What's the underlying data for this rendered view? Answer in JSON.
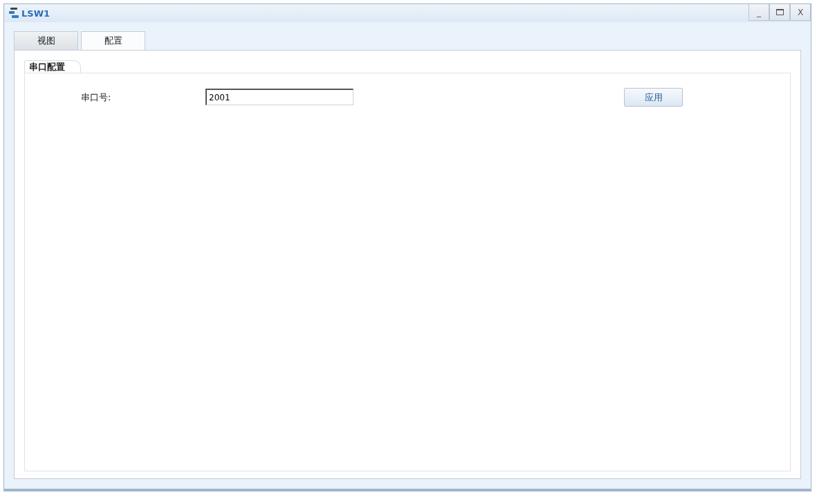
{
  "window": {
    "title": "LSW1"
  },
  "window_controls": [
    "_",
    "X"
  ],
  "tabs": [
    {
      "label": "视图",
      "selected": false
    },
    {
      "label": "配置",
      "selected": true
    }
  ],
  "sub_tabs": [
    {
      "label": "串口配置",
      "selected": true
    }
  ],
  "form": {
    "label": "串口号:",
    "value": "2001"
  },
  "buttons": [
    "应用"
  ]
}
